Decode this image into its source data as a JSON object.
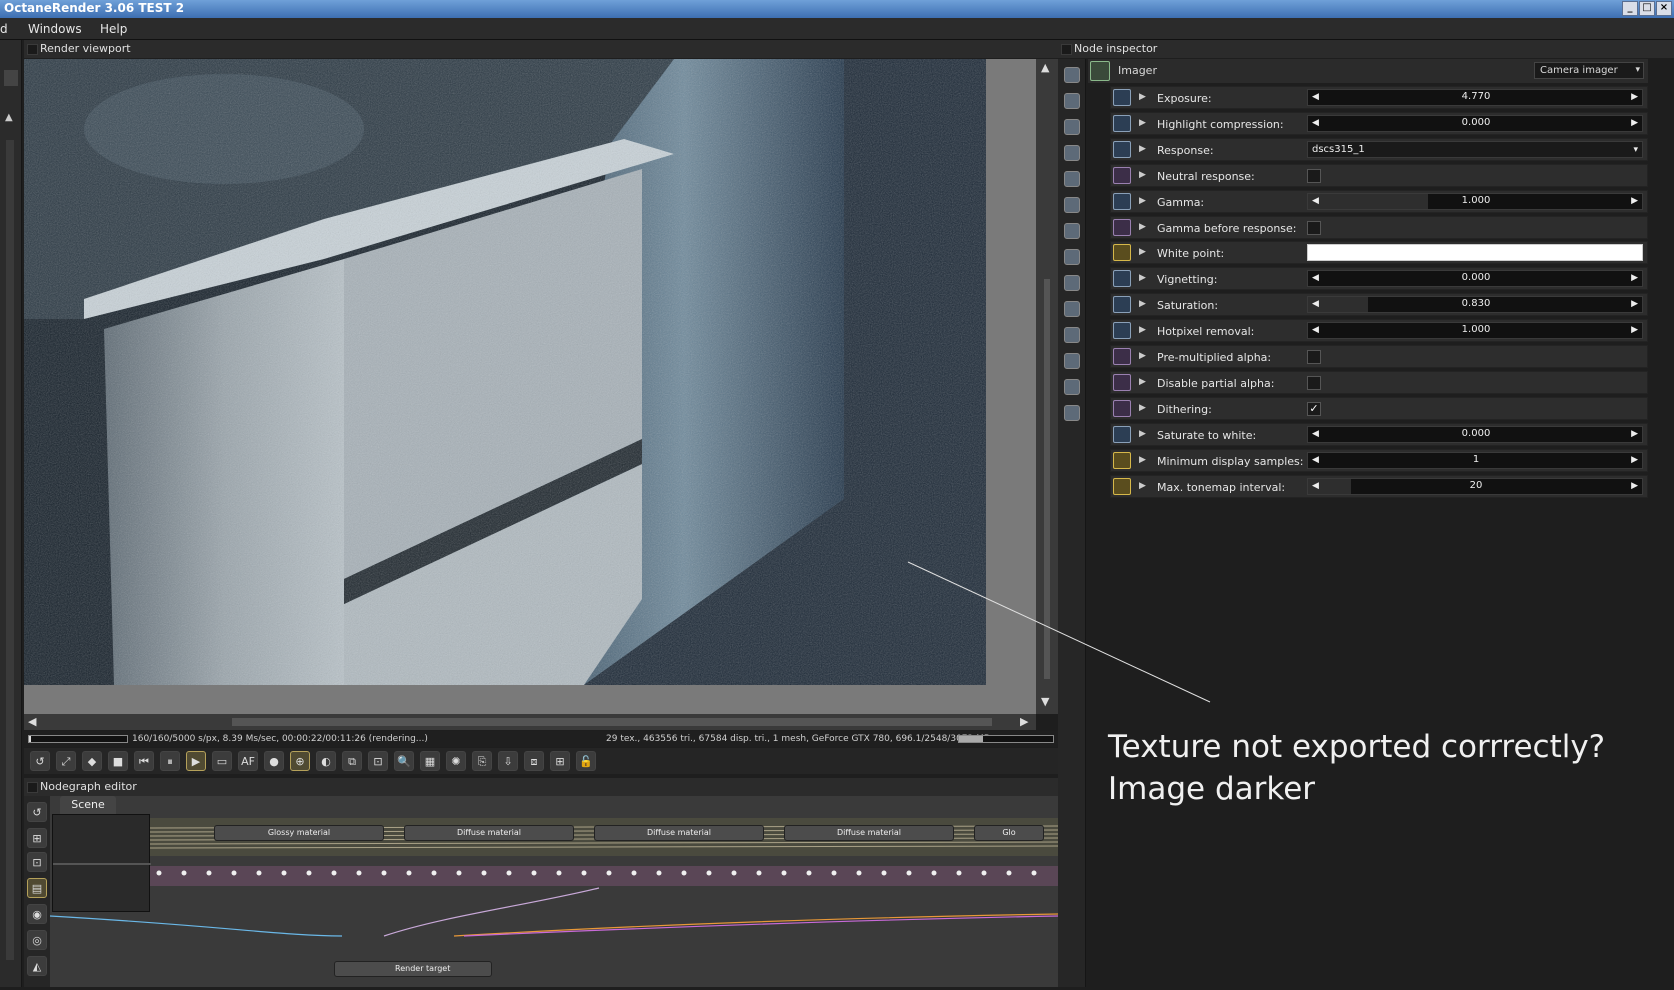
{
  "window": {
    "title": "OctaneRender 3.06 TEST 2",
    "buttons": [
      "_",
      "□",
      "×"
    ]
  },
  "menu": {
    "items": [
      "d",
      "Windows",
      "Help"
    ]
  },
  "viewport": {
    "title": "Render viewport"
  },
  "status": {
    "left": "160/160/5000 s/px, 8.39 Ms/sec, 00:00:22/00:11:26 (rendering...)",
    "right": "29 tex., 463556 tri., 67584 disp. tri., 1 mesh, GeForce GTX 780, 696.1/2548/3072 MB"
  },
  "toolbar_icons": [
    "reload-icon",
    "scale-icon",
    "cube-icon",
    "stop-icon",
    "rewind-icon",
    "pause-icon",
    "play-icon",
    "display-icon",
    "af-icon",
    "color-icon",
    "lock-icon",
    "film-icon",
    "region-icon",
    "focus-icon",
    "picker-icon",
    "spinner-icon",
    "zoom-icon",
    "square-icon",
    "clone-icon",
    "export-icon",
    "crop-icon",
    "script-icon"
  ],
  "toolbar_glyphs": [
    "↺",
    "⤢",
    "◆",
    "■",
    "⏮",
    "⏸",
    "▶",
    "▭",
    "AF",
    "●",
    "⊕",
    "◐",
    "⧉",
    "⊡",
    "🔍",
    "▦",
    "✺",
    "⎘",
    "⇩",
    "⧈",
    "⊞",
    "🔓"
  ],
  "nodegraph": {
    "title": "Nodegraph editor",
    "tab": "Scene",
    "nodes": [
      "Glossy material",
      "Diffuse material",
      "Diffuse material",
      "Diffuse material",
      "Glo"
    ],
    "render_target": "Render target"
  },
  "inspector": {
    "title": "Node inspector",
    "imager_label": "Imager",
    "imager_type": "Camera imager",
    "rows": [
      {
        "label": "Exposure:",
        "kind": "slider",
        "value": "4.770",
        "fill": 0.0,
        "icon": "blue"
      },
      {
        "label": "Highlight compression:",
        "kind": "slider",
        "value": "0.000",
        "fill": 0.0,
        "icon": "blue"
      },
      {
        "label": "Response:",
        "kind": "combo",
        "value": "dscs315_1",
        "icon": "blue"
      },
      {
        "label": "Neutral response:",
        "kind": "check",
        "checked": false,
        "icon": "pink"
      },
      {
        "label": "Gamma:",
        "kind": "slider",
        "value": "1.000",
        "fill": 0.36,
        "icon": "blue"
      },
      {
        "label": "Gamma before response:",
        "kind": "check",
        "checked": false,
        "icon": "pink"
      },
      {
        "label": "White point:",
        "kind": "color",
        "color": "#ffffff",
        "icon": "yellow"
      },
      {
        "label": "Vignetting:",
        "kind": "slider",
        "value": "0.000",
        "fill": 0.0,
        "icon": "blue"
      },
      {
        "label": "Saturation:",
        "kind": "slider",
        "value": "0.830",
        "fill": 0.18,
        "icon": "blue"
      },
      {
        "label": "Hotpixel removal:",
        "kind": "slider",
        "value": "1.000",
        "fill": 0.0,
        "icon": "blue"
      },
      {
        "label": "Pre-multiplied alpha:",
        "kind": "check",
        "checked": false,
        "icon": "pink"
      },
      {
        "label": "Disable partial alpha:",
        "kind": "check",
        "checked": false,
        "icon": "pink"
      },
      {
        "label": "Dithering:",
        "kind": "check",
        "checked": true,
        "icon": "pink"
      },
      {
        "label": "Saturate to white:",
        "kind": "slider",
        "value": "0.000",
        "fill": 0.0,
        "icon": "blue"
      },
      {
        "label": "Minimum display samples:",
        "kind": "slider",
        "value": "1",
        "fill": 0.0,
        "icon": "yellow"
      },
      {
        "label": "Max. tonemap interval:",
        "kind": "slider",
        "value": "20",
        "fill": 0.13,
        "icon": "yellow"
      }
    ]
  },
  "annotation": {
    "line1": "Texture not exported corrrectly?",
    "line2": "Image darker"
  }
}
